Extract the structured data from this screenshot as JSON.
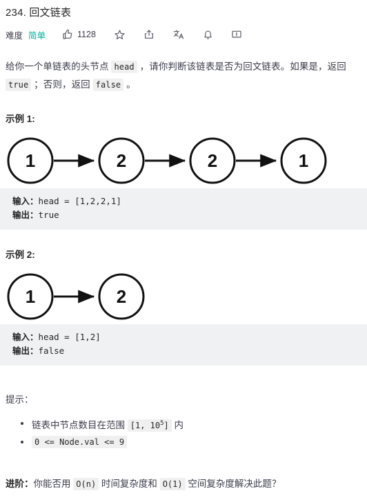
{
  "header": {
    "title": "234. 回文链表",
    "difficulty_label": "难度",
    "difficulty_value": "简单",
    "difficulty_color": "#00af9b",
    "like_count": "1128",
    "icons": [
      "thumbs-up-icon",
      "star-icon",
      "share-icon",
      "translate-icon",
      "bell-icon",
      "feedback-icon"
    ]
  },
  "description": {
    "part1": "给你一个单链表的头节点 ",
    "code1": "head",
    "part2": " ，请你判断该链表是否为回文链表。如果是，返回 ",
    "code2": "true",
    "part3": " ；否则，返回 ",
    "code3": "false",
    "part4": " 。"
  },
  "examples": [
    {
      "heading": "示例 1:",
      "nodes": [
        "1",
        "2",
        "2",
        "1"
      ],
      "input_label": "输入：",
      "input_value": "head = [1,2,2,1]",
      "output_label": "输出：",
      "output_value": "true"
    },
    {
      "heading": "示例 2:",
      "nodes": [
        "1",
        "2"
      ],
      "input_label": "输入：",
      "input_value": "head = [1,2]",
      "output_label": "输出：",
      "output_value": "false"
    }
  ],
  "hints": {
    "heading": "提示：",
    "items": [
      {
        "prefix": "链表中节点数目在范围 ",
        "code_pre": "[1, 10",
        "code_sup": "5",
        "code_post": "]",
        "suffix": " 内"
      },
      {
        "prefix": "",
        "code_pre": "0 <= Node.val <= 9",
        "code_sup": "",
        "code_post": "",
        "suffix": ""
      }
    ]
  },
  "advanced": {
    "label": "进阶：",
    "part1": "你能否用 ",
    "code1": "O(n)",
    "part2": " 时间复杂度和 ",
    "code2": "O(1)",
    "part3": " 空间复杂度解决此题？"
  }
}
